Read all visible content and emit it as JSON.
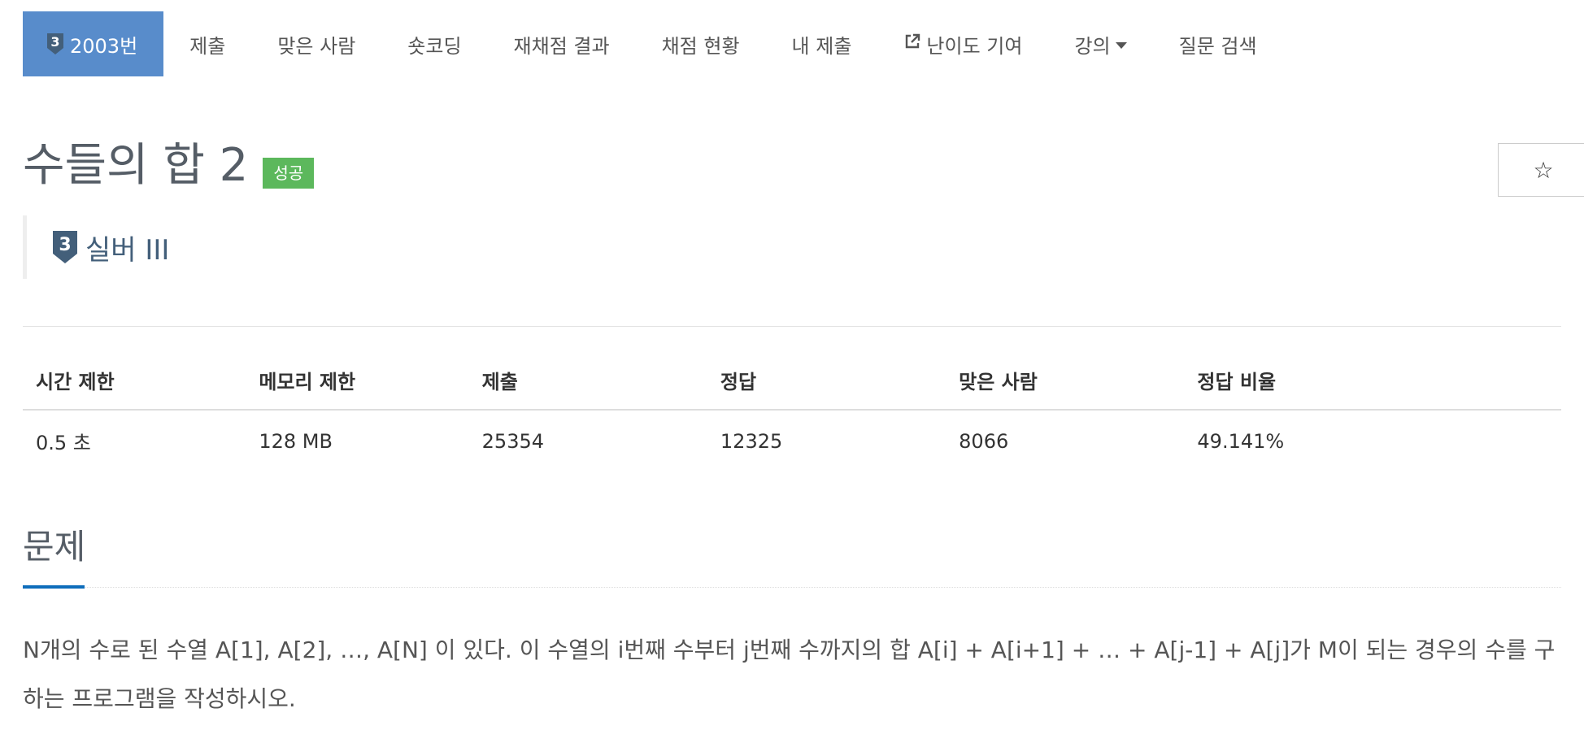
{
  "nav": {
    "problem_tab": "2003번",
    "items": [
      "제출",
      "맞은 사람",
      "숏코딩",
      "재채점 결과",
      "채점 현황",
      "내 제출",
      "난이도 기여",
      "강의",
      "질문 검색"
    ]
  },
  "tier": {
    "number": "3",
    "label": "실버 III",
    "color": "#435f7a"
  },
  "problem": {
    "title": "수들의 합 2",
    "result_badge": "성공",
    "star": "☆"
  },
  "info_table": {
    "headers": [
      "시간 제한",
      "메모리 제한",
      "제출",
      "정답",
      "맞은 사람",
      "정답 비율"
    ],
    "values": [
      "0.5 초",
      "128 MB",
      "25354",
      "12325",
      "8066",
      "49.141%"
    ]
  },
  "section": {
    "title": "문제",
    "text": "N개의 수로 된 수열 A[1], A[2], …, A[N] 이 있다. 이 수열의 i번째 수부터 j번째 수까지의 합 A[i] + A[i+1] + … + A[j-1] + A[j]가 M이 되는 경우의 수를 구하는 프로그램을 작성하시오."
  },
  "colors": {
    "accent": "#588ccb",
    "success": "#5cb85c",
    "section_underline": "#0e6dbb"
  }
}
